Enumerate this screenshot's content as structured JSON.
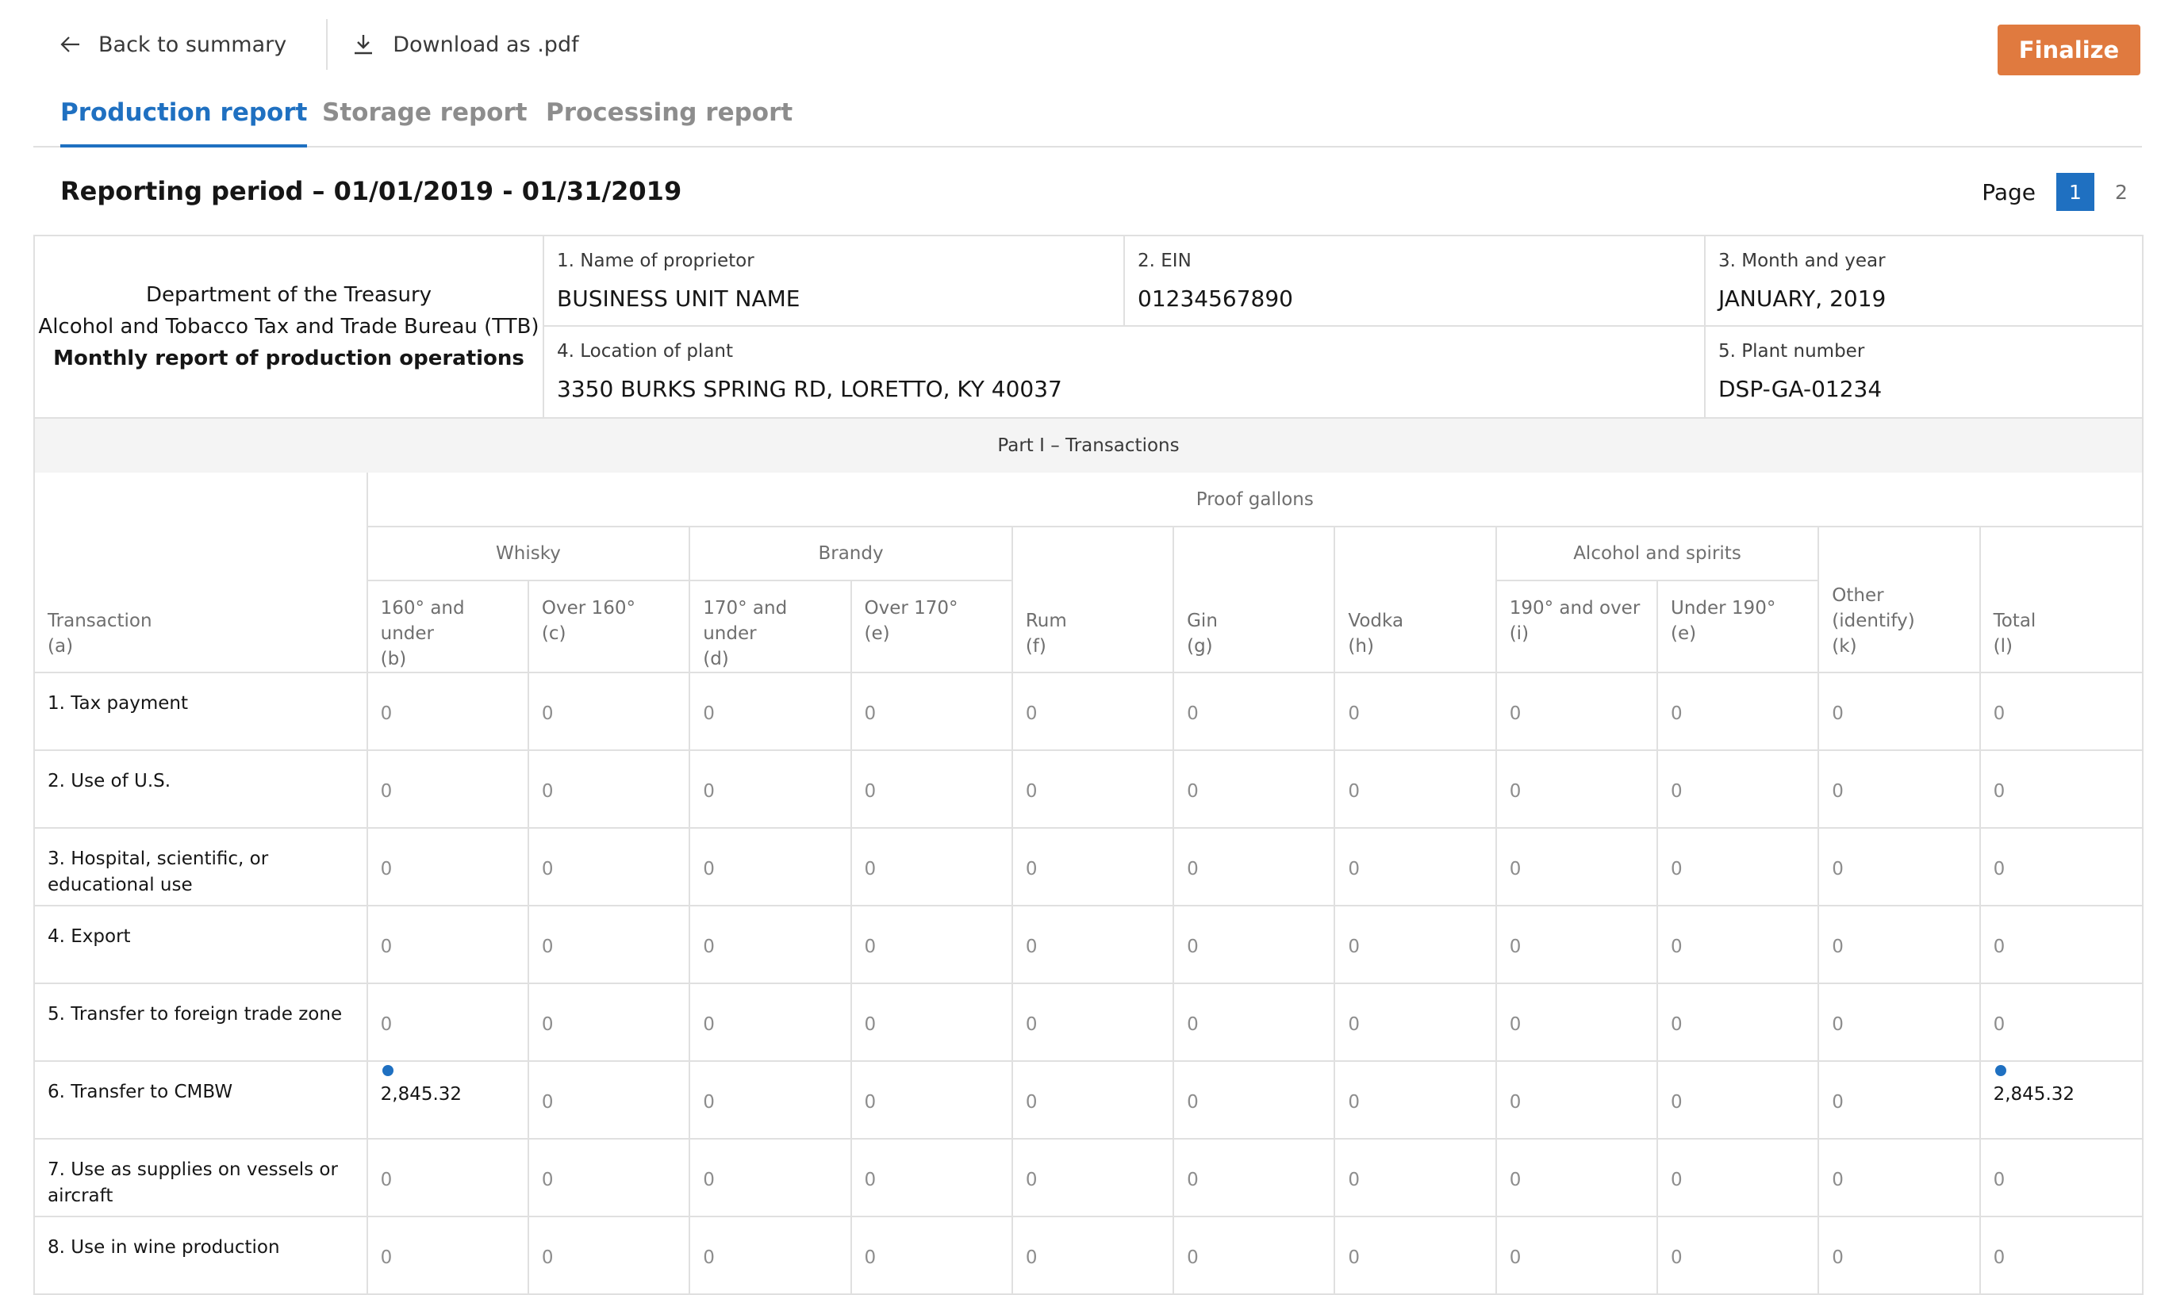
{
  "toolbar": {
    "back_label": "Back to summary",
    "download_label": "Download as .pdf",
    "finalize_label": "Finalize",
    "finalize_color": "#e07a3f"
  },
  "tabs": [
    {
      "label": "Production report",
      "active": true
    },
    {
      "label": "Storage report",
      "active": false
    },
    {
      "label": "Processing report",
      "active": false
    }
  ],
  "accent_color": "#1f70c1",
  "period": {
    "title": "Reporting period – 01/01/2019 - 01/31/2019",
    "page_label": "Page",
    "pages": [
      "1",
      "2"
    ],
    "current_page": "1"
  },
  "report": {
    "dept_line1": "Department of the Treasury",
    "dept_line2": "Alcohol and Tobacco Tax and Trade Bureau (TTB)",
    "dept_line3": "Monthly report of production operations",
    "fields": {
      "name": {
        "label": "1. Name of proprietor",
        "value": "BUSINESS UNIT NAME"
      },
      "ein": {
        "label": "2. EIN",
        "value": "01234567890"
      },
      "month": {
        "label": "3. Month and year",
        "value": "JANUARY, 2019"
      },
      "location": {
        "label": "4. Location of plant",
        "value": "3350 BURKS SPRING RD, LORETTO, KY 40037"
      },
      "plant": {
        "label": "5. Plant number",
        "value": "DSP-GA-01234"
      }
    },
    "part_title": "Part I – Transactions",
    "proof_gallons": "Proof gallons",
    "groups": {
      "whisky": "Whisky",
      "brandy": "Brandy",
      "alcohol": "Alcohol and spirits"
    },
    "transaction_header": [
      "Transaction",
      "(a)"
    ],
    "columns": [
      [
        "160° and under",
        "(b)"
      ],
      [
        "Over 160°",
        "(c)"
      ],
      [
        "170° and under",
        "(d)"
      ],
      [
        "Over 170°",
        "(e)"
      ],
      [
        "Rum",
        "(f)"
      ],
      [
        "Gin",
        "(g)"
      ],
      [
        "Vodka",
        "(h)"
      ],
      [
        "190° and over",
        "(i)"
      ],
      [
        "Under 190°",
        "(e)"
      ],
      [
        "Other (identify)",
        "(k)"
      ],
      [
        "Total",
        "(l)"
      ]
    ],
    "rows": [
      {
        "label": "1. Tax payment",
        "values": [
          "0",
          "0",
          "0",
          "0",
          "0",
          "0",
          "0",
          "0",
          "0",
          "0",
          "0"
        ]
      },
      {
        "label": "2. Use of U.S.",
        "values": [
          "0",
          "0",
          "0",
          "0",
          "0",
          "0",
          "0",
          "0",
          "0",
          "0",
          "0"
        ]
      },
      {
        "label": "3. Hospital, scientific, or educational use",
        "values": [
          "0",
          "0",
          "0",
          "0",
          "0",
          "0",
          "0",
          "0",
          "0",
          "0",
          "0"
        ]
      },
      {
        "label": "4. Export",
        "values": [
          "0",
          "0",
          "0",
          "0",
          "0",
          "0",
          "0",
          "0",
          "0",
          "0",
          "0"
        ]
      },
      {
        "label": "5. Transfer to foreign trade zone",
        "values": [
          "0",
          "0",
          "0",
          "0",
          "0",
          "0",
          "0",
          "0",
          "0",
          "0",
          "0"
        ]
      },
      {
        "label": "6. Transfer to CMBW",
        "values": [
          "2,845.32",
          "0",
          "0",
          "0",
          "0",
          "0",
          "0",
          "0",
          "0",
          "0",
          "2,845.32"
        ],
        "marked": [
          0,
          10
        ]
      },
      {
        "label": "7. Use as supplies on vessels or aircraft",
        "values": [
          "0",
          "0",
          "0",
          "0",
          "0",
          "0",
          "0",
          "0",
          "0",
          "0",
          "0"
        ]
      },
      {
        "label": "8. Use in wine production",
        "values": [
          "0",
          "0",
          "0",
          "0",
          "0",
          "0",
          "0",
          "0",
          "0",
          "0",
          "0"
        ]
      }
    ]
  }
}
